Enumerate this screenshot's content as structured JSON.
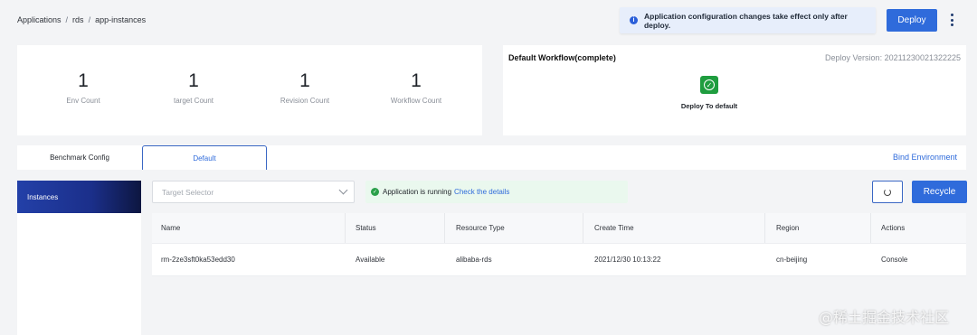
{
  "breadcrumb": {
    "items": [
      "Applications",
      "rds",
      "app-instances"
    ],
    "separator": "/"
  },
  "header": {
    "notice": "Application configuration changes take effect only after deploy.",
    "deploy_label": "Deploy"
  },
  "stats": [
    {
      "value": "1",
      "label": "Env Count"
    },
    {
      "value": "1",
      "label": "target Count"
    },
    {
      "value": "1",
      "label": "Revision Count"
    },
    {
      "value": "1",
      "label": "Workflow Count"
    }
  ],
  "workflow": {
    "title": "Default Workflow(complete)",
    "version": "Deploy Version: 20211230021322225",
    "step_label": "Deploy To default"
  },
  "tabs": {
    "items": [
      "Benchmark Config",
      "Default"
    ],
    "active": "Default",
    "bind_environment": "Bind Environment"
  },
  "sidebar": {
    "items": [
      "Instances"
    ]
  },
  "toolbar": {
    "selector_placeholder": "Target Selector",
    "status_text": "Application is running",
    "status_link": "Check the details",
    "recycle_label": "Recycle"
  },
  "table": {
    "columns": [
      "Name",
      "Status",
      "Resource Type",
      "Create Time",
      "Region",
      "Actions"
    ],
    "rows": [
      {
        "name": "rm-2ze3sft0ka53edd30",
        "status": "Available",
        "resource_type": "alibaba-rds",
        "create_time": "2021/12/30 10:13:22",
        "region": "cn-beijing",
        "action": "Console"
      }
    ]
  },
  "watermark": "@稀土掘金技术社区",
  "colors": {
    "primary": "#2f6bdb",
    "success": "#1f9d3f",
    "sidebar_active": "#1b2f8a"
  }
}
